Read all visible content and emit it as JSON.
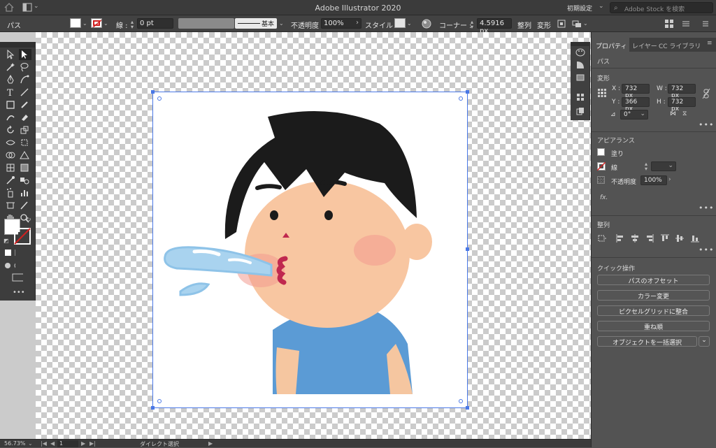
{
  "window": {
    "title": "Adobe Illustrator 2020",
    "workspace_preset": "初期設定",
    "stock_search_placeholder": "Adobe Stock を検索"
  },
  "control_bar": {
    "selection_label": "パス",
    "stroke_label": "線 :",
    "stroke_weight": "0 pt",
    "stroke_style": "基本",
    "opacity_label": "不透明度 :",
    "opacity_value": "100%",
    "style_label": "スタイル :",
    "corner_label": "コーナー :",
    "corner_value": "4.5916 px",
    "align_label": "整列",
    "transform_label": "変形"
  },
  "properties_panel": {
    "tabs": [
      "プロパティ",
      "レイヤー",
      "CC ライブラリ"
    ],
    "object_type": "パス",
    "transform": {
      "title": "変形",
      "x_label": "X :",
      "x": "732 px",
      "y_label": "Y :",
      "y": "366 px",
      "w_label": "W :",
      "w": "732 px",
      "h_label": "H :",
      "h": "732 px",
      "angle": "0°"
    },
    "appearance": {
      "title": "アピアランス",
      "fill_label": "塗り",
      "stroke_label": "線",
      "opacity_label": "不透明度",
      "opacity_value": "100%",
      "fx_label": "fx."
    },
    "align": {
      "title": "整列"
    },
    "quick_actions": {
      "title": "クイック操作",
      "buttons": [
        "パスのオフセット",
        "カラー変更",
        "ピクセルグリッドに整合",
        "重ね順",
        "オブジェクトを一括選択"
      ]
    }
  },
  "status_bar": {
    "zoom": "56.73%",
    "artboard": "1",
    "current_tool": "ダイレクト選択"
  },
  "colors": {
    "selection_blue": "#4a78e6",
    "panel_bg": "#535353",
    "stroke_none_red": "#d02020"
  }
}
